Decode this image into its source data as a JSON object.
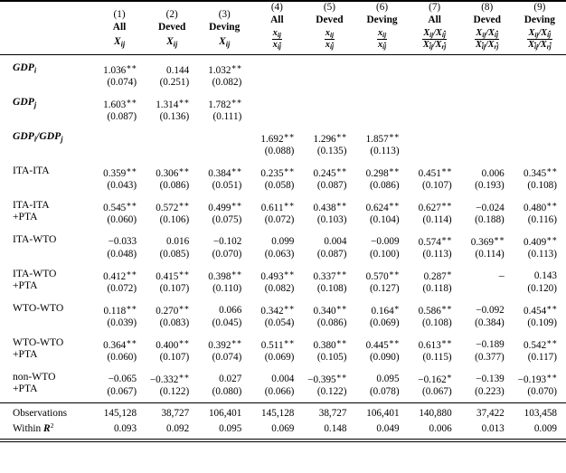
{
  "table": {
    "columns": [
      {
        "number": "(1)",
        "group": "All",
        "dep_num": "X_ij",
        "dep_den": null
      },
      {
        "number": "(2)",
        "group": "Deved",
        "dep_num": "X_ij",
        "dep_den": null
      },
      {
        "number": "(3)",
        "group": "Deving",
        "dep_num": "X_ij",
        "dep_den": null
      },
      {
        "number": "(4)",
        "group": "All",
        "dep_num": "x_ij",
        "dep_den": "x_ij̄"
      },
      {
        "number": "(5)",
        "group": "Deved",
        "dep_num": "x_ij",
        "dep_den": "x_ij̄"
      },
      {
        "number": "(6)",
        "group": "Deving",
        "dep_num": "x_ij",
        "dep_den": "x_ij̄"
      },
      {
        "number": "(7)",
        "group": "All",
        "dep_num": "X_ij/X_ij̄",
        "dep_den": "X_īj/X_rj̄"
      },
      {
        "number": "(8)",
        "group": "Deved",
        "dep_num": "X_ij/X_ij̄",
        "dep_den": "X_īj/X_rj̄"
      },
      {
        "number": "(9)",
        "group": "Deving",
        "dep_num": "X_ij/X_ij̄",
        "dep_den": "X_īj/X_rj̄"
      }
    ],
    "rows": [
      {
        "label_line1": "GDP_i",
        "label_line2": "",
        "coefs": [
          "1.036**",
          "0.144",
          "1.032**",
          "",
          "",
          "",
          "",
          "",
          ""
        ],
        "ses": [
          "(0.074)",
          "(0.251)",
          "(0.082)",
          "",
          "",
          "",
          "",
          "",
          ""
        ]
      },
      {
        "label_line1": "GDP_j",
        "label_line2": "",
        "coefs": [
          "1.603**",
          "1.314**",
          "1.782**",
          "",
          "",
          "",
          "",
          "",
          ""
        ],
        "ses": [
          "(0.087)",
          "(0.136)",
          "(0.111)",
          "",
          "",
          "",
          "",
          "",
          ""
        ]
      },
      {
        "label_line1": "GDP_i/GDP_j",
        "label_line2": "",
        "coefs": [
          "",
          "",
          "",
          "1.692**",
          "1.296**",
          "1.857**",
          "",
          "",
          ""
        ],
        "ses": [
          "",
          "",
          "",
          "(0.088)",
          "(0.135)",
          "(0.113)",
          "",
          "",
          ""
        ]
      },
      {
        "label_line1": "ITA-ITA",
        "label_line2": "",
        "coefs": [
          "0.359**",
          "0.306**",
          "0.384**",
          "0.235**",
          "0.245**",
          "0.298**",
          "0.451**",
          "0.006",
          "0.345**"
        ],
        "ses": [
          "(0.043)",
          "(0.086)",
          "(0.051)",
          "(0.058)",
          "(0.087)",
          "(0.086)",
          "(0.107)",
          "(0.193)",
          "(0.108)"
        ]
      },
      {
        "label_line1": "ITA-ITA",
        "label_line2": "+PTA",
        "coefs": [
          "0.545**",
          "0.572**",
          "0.499**",
          "0.611**",
          "0.438**",
          "0.624**",
          "0.627**",
          "−0.024",
          "0.480**"
        ],
        "ses": [
          "(0.060)",
          "(0.106)",
          "(0.075)",
          "(0.072)",
          "(0.103)",
          "(0.104)",
          "(0.114)",
          "(0.188)",
          "(0.116)"
        ]
      },
      {
        "label_line1": "ITA-WTO",
        "label_line2": "",
        "coefs": [
          "−0.033",
          "0.016",
          "−0.102",
          "0.099",
          "0.004",
          "−0.009",
          "0.574**",
          "0.369**",
          "0.409**"
        ],
        "ses": [
          "(0.048)",
          "(0.085)",
          "(0.070)",
          "(0.063)",
          "(0.087)",
          "(0.100)",
          "(0.113)",
          "(0.114)",
          "(0.113)"
        ]
      },
      {
        "label_line1": "ITA-WTO",
        "label_line2": "+PTA",
        "coefs": [
          "0.412**",
          "0.415**",
          "0.398**",
          "0.493**",
          "0.337**",
          "0.570**",
          "0.287*",
          "–",
          "0.143"
        ],
        "ses": [
          "(0.072)",
          "(0.107)",
          "(0.110)",
          "(0.082)",
          "(0.108)",
          "(0.127)",
          "(0.118)",
          "",
          "(0.120)"
        ]
      },
      {
        "label_line1": "WTO-WTO",
        "label_line2": "",
        "coefs": [
          "0.118**",
          "0.270**",
          "0.066",
          "0.342**",
          "0.340**",
          "0.164*",
          "0.586**",
          "−0.092",
          "0.454**"
        ],
        "ses": [
          "(0.039)",
          "(0.083)",
          "(0.045)",
          "(0.054)",
          "(0.086)",
          "(0.069)",
          "(0.108)",
          "(0.384)",
          "(0.109)"
        ]
      },
      {
        "label_line1": "WTO-WTO",
        "label_line2": "+PTA",
        "coefs": [
          "0.364**",
          "0.400**",
          "0.392**",
          "0.511**",
          "0.380**",
          "0.445**",
          "0.613**",
          "−0.189",
          "0.542**"
        ],
        "ses": [
          "(0.060)",
          "(0.107)",
          "(0.074)",
          "(0.069)",
          "(0.105)",
          "(0.090)",
          "(0.115)",
          "(0.377)",
          "(0.117)"
        ]
      },
      {
        "label_line1": "non-WTO",
        "label_line2": "+PTA",
        "coefs": [
          "−0.065",
          "−0.332**",
          "0.027",
          "0.004",
          "−0.395**",
          "0.095",
          "−0.162*",
          "−0.139",
          "−0.193**"
        ],
        "ses": [
          "(0.067)",
          "(0.122)",
          "(0.080)",
          "(0.066)",
          "(0.122)",
          "(0.078)",
          "(0.067)",
          "(0.223)",
          "(0.070)"
        ]
      }
    ],
    "footer": {
      "observations_label": "Observations",
      "observations": [
        "145,128",
        "38,727",
        "106,401",
        "145,128",
        "38,727",
        "106,401",
        "140,880",
        "37,422",
        "103,458"
      ],
      "within_r2_label": "Within R2",
      "within_r2": [
        "0.093",
        "0.092",
        "0.095",
        "0.069",
        "0.148",
        "0.049",
        "0.006",
        "0.013",
        "0.009"
      ]
    }
  }
}
